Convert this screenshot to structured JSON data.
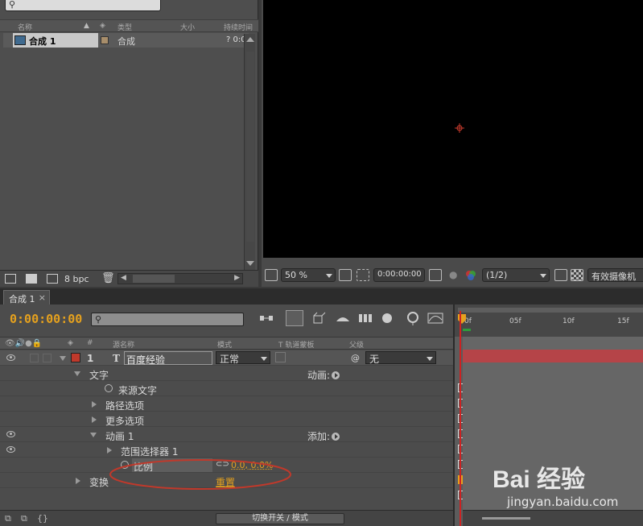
{
  "project": {
    "columns": [
      "名称",
      "类型",
      "大小",
      "持续时间"
    ],
    "item": {
      "name": "合成 1",
      "type": "合成",
      "duration": "? 0:0"
    },
    "footer": {
      "bpc": "8 bpc"
    }
  },
  "viewer": {
    "zoom": "50 %",
    "timecode": "0:00:00:00",
    "resolution": "(1/2)",
    "camera": "有效摄像机"
  },
  "timeline": {
    "tab": "合成 1",
    "tab_close": "×",
    "timecode": "0:00:00:00",
    "columns": {
      "number": "#",
      "source": "源名称",
      "mode": "模式",
      "trkmat": "T  轨道蒙板",
      "parent": "父级"
    },
    "layer": {
      "number": "1",
      "name": "百度经验",
      "mode": "正常",
      "parent": "无",
      "label_color": "#c0392b"
    },
    "rows": {
      "text": "文字",
      "animate_label": "动画:",
      "source_text": "来源文字",
      "path_options": "路径选项",
      "more_options": "更多选项",
      "animator": "动画 1",
      "add_label": "添加:",
      "range_selector": "范围选择器 1",
      "scale": "比例",
      "scale_value": "0.0, 0.0%",
      "transform": "变换",
      "reset": "重置"
    },
    "footer": {
      "switch": "切换开关 / 模式"
    },
    "ruler": {
      "ticks": [
        "0f",
        "05f",
        "10f",
        "15f"
      ]
    }
  },
  "watermark": {
    "text": "Bai 经验",
    "url": "jingyan.baidu.com"
  },
  "colors": {
    "timecode": "#e5a11e",
    "layer_bar": "#b54448",
    "value": "#e5a11e",
    "annotation": "#c0392b"
  }
}
